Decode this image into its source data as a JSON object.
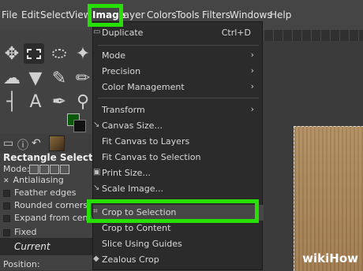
{
  "menubar": {
    "items": [
      "File",
      "Edit",
      "Select",
      "View",
      "Image",
      "Layer",
      "Colors",
      "Tools",
      "Filters",
      "Windows",
      "Help"
    ],
    "active_item": "Image",
    "highlight_color": "#25e000"
  },
  "image_menu": {
    "items": [
      {
        "label": "Duplicate",
        "shortcut": "Ctrl+D"
      },
      {
        "label": "Mode",
        "submenu": true
      },
      {
        "label": "Precision",
        "submenu": true
      },
      {
        "label": "Color Management",
        "submenu": true
      },
      {
        "label": "Transform",
        "submenu": true
      },
      {
        "label": "Canvas Size..."
      },
      {
        "label": "Fit Canvas to Layers"
      },
      {
        "label": "Fit Canvas to Selection"
      },
      {
        "label": "Print Size..."
      },
      {
        "label": "Scale Image..."
      },
      {
        "label": "Crop to Selection",
        "highlighted": true
      },
      {
        "label": "Crop to Content"
      },
      {
        "label": "Slice Using Guides"
      },
      {
        "label": "Zealous Crop"
      }
    ],
    "arrow_glyph": "›"
  },
  "toolbox": {
    "tool_options_title": "Rectangle Select",
    "mode_label": "Mode:",
    "options": [
      {
        "label": "Antialiasing",
        "checked": true
      },
      {
        "label": "Feather edges",
        "checked": false
      },
      {
        "label": "Rounded corners",
        "checked": false
      },
      {
        "label": "Expand from center",
        "checked": false
      },
      {
        "label": "Fixed",
        "checked": false
      }
    ],
    "fixed_value": "Current",
    "position_label": "Position:",
    "fg_color": "#0b5a0b",
    "bg_color": "#111111"
  },
  "watermark": {
    "wiki": "wiki",
    "how": "How"
  }
}
